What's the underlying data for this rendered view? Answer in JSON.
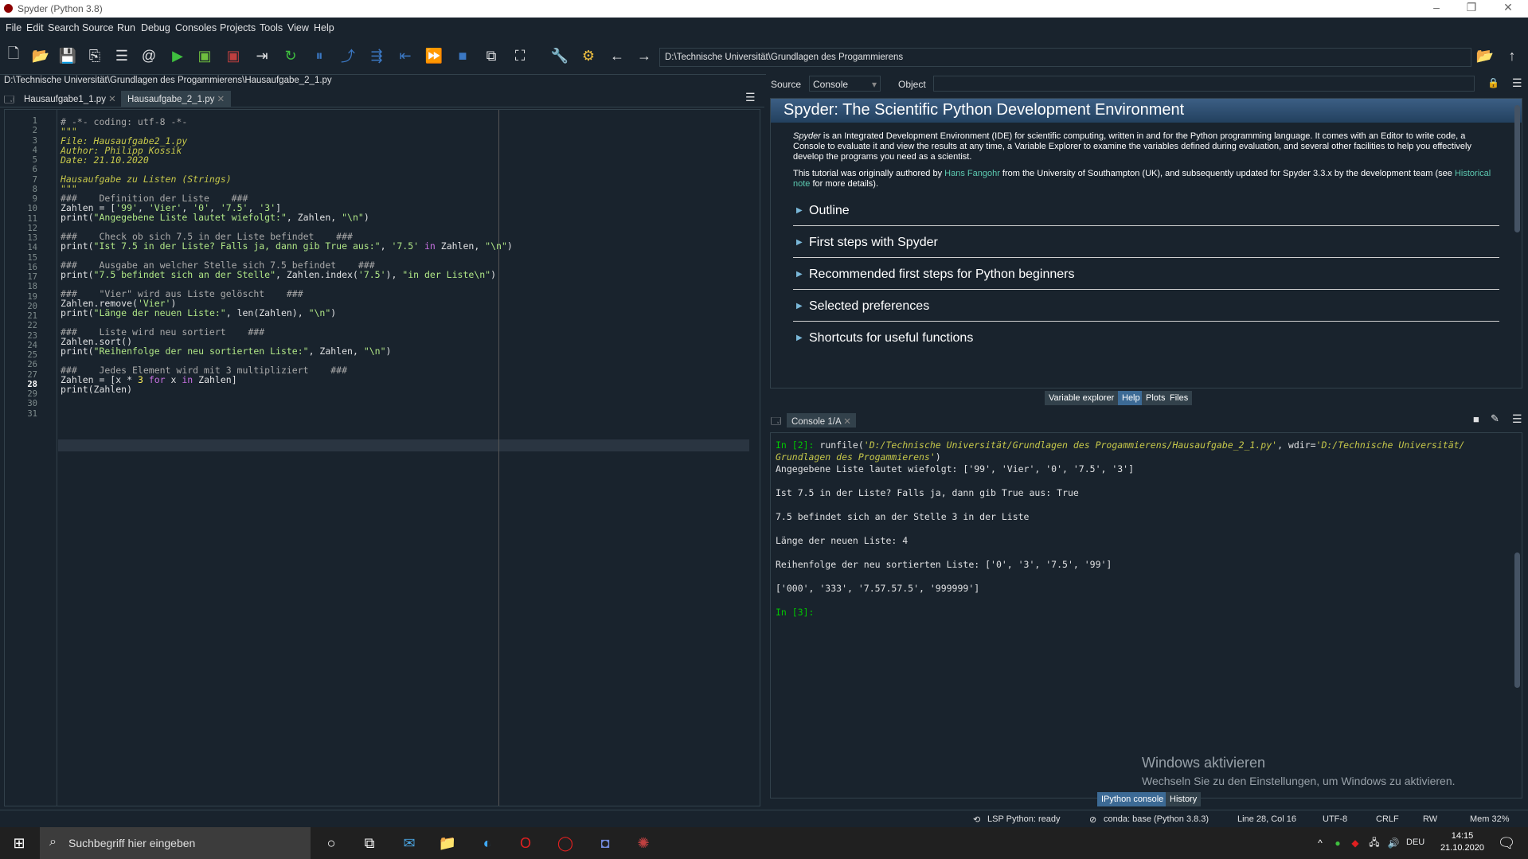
{
  "window": {
    "title": "Spyder (Python 3.8)"
  },
  "menu": [
    "File",
    "Edit",
    "Search",
    "Source",
    "Run",
    "Debug",
    "Consoles",
    "Projects",
    "Tools",
    "View",
    "Help"
  ],
  "toolbar": {
    "path": "D:\\Technische Universität\\Grundlagen des Progammierens"
  },
  "editor": {
    "filepath": "D:\\Technische Universität\\Grundlagen des Progammierens\\Hausaufgabe_2_1.py",
    "tabs": [
      "Hausaufgabe1_1.py",
      "Hausaufgabe_2_1.py"
    ],
    "lines": [
      "1",
      "2",
      "3",
      "4",
      "5",
      "6",
      "7",
      "8",
      "9",
      "10",
      "11",
      "12",
      "13",
      "14",
      "15",
      "16",
      "17",
      "18",
      "19",
      "20",
      "21",
      "22",
      "23",
      "24",
      "25",
      "26",
      "27",
      "28",
      "29",
      "30",
      "31"
    ]
  },
  "help": {
    "source_label": "Source",
    "source_value": "Console",
    "object_label": "Object",
    "title": "Spyder: The Scientific Python Development Environment",
    "para1_italic": "Spyder",
    "para1": " is an Integrated Development Environment (IDE) for scientific computing, written in and for the Python programming language. It comes with an Editor to write code, a Console to evaluate it and view the results at any time, a Variable Explorer to examine the variables defined during evaluation, and several other facilities to help you effectively develop the programs you need as a scientist.",
    "para2a": "This tutorial was originally authored by ",
    "para2_link": "Hans Fangohr",
    "para2b": " from the University of Southampton (UK), and subsequently updated for Spyder 3.3.x by the development team (see ",
    "para2_link2": "Historical note",
    "para2c": " for more details).",
    "sections": [
      "Outline",
      "First steps with Spyder",
      "Recommended first steps for Python beginners",
      "Selected preferences",
      "Shortcuts for useful functions"
    ],
    "tabs": [
      "Variable explorer",
      "Help",
      "Plots",
      "Files"
    ]
  },
  "console": {
    "tab": "Console 1/A",
    "in2_prompt": "In [2]:",
    "in2_cmd": " runfile(",
    "in2_arg": "'D:/Technische Universität/Grundlagen des Progammierens/Hausaufgabe_2_1.py'",
    "in2_mid": ", wdir=",
    "in2_wdir1": "'D:/Technische Universität/",
    "in2_wdir2": "Grundlagen des Progammierens'",
    "in2_end": ")",
    "outputs": [
      "Angegebene Liste lautet wiefolgt: ['99', 'Vier', '0', '7.5', '3']",
      "Ist 7.5 in der Liste? Falls ja, dann gib True aus: True",
      "7.5 befindet sich an der Stelle 3 in der Liste",
      "Länge der neuen Liste: 4",
      "Reihenfolge der neu sortierten Liste: ['0', '3', '7.5', '99']",
      "['000', '333', '7.57.57.5', '999999']"
    ],
    "in3_prompt": "In [3]:",
    "tabs": [
      "IPython console",
      "History"
    ]
  },
  "watermark": {
    "line1": "Windows aktivieren",
    "line2": "Wechseln Sie zu den Einstellungen, um Windows zu aktivieren."
  },
  "status": {
    "lsp": "LSP Python: ready",
    "conda": "conda: base (Python 3.8.3)",
    "pos": "Line 28, Col 16",
    "enc": "UTF-8",
    "eol": "CRLF",
    "rw": "RW",
    "mem": "Mem 32%"
  },
  "taskbar": {
    "search_placeholder": "Suchbegriff hier eingeben",
    "lang": "DEU",
    "time": "14:15",
    "date": "21.10.2020"
  }
}
